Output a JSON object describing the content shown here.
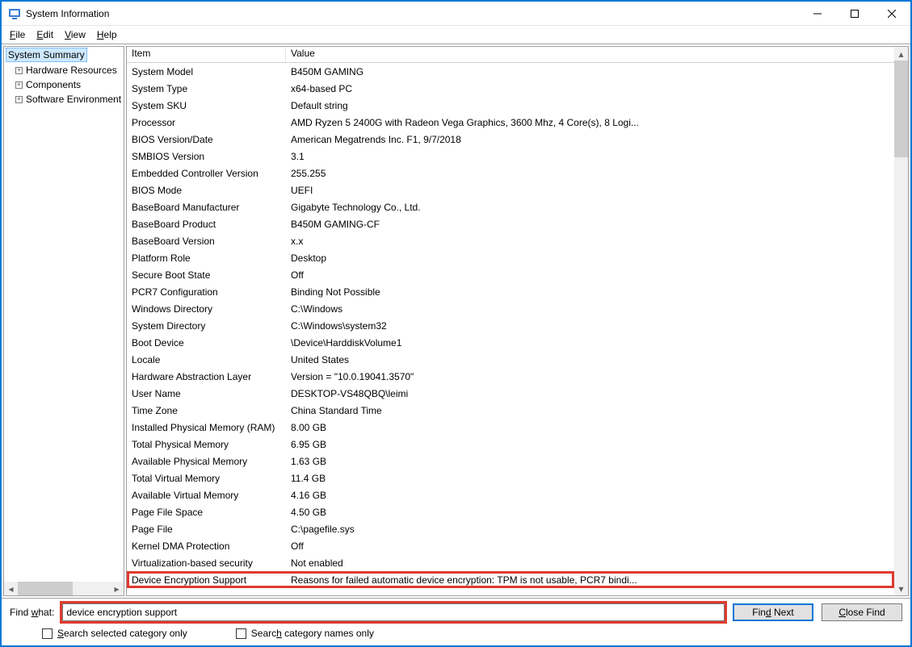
{
  "window": {
    "title": "System Information"
  },
  "menu": {
    "file": "File",
    "edit": "Edit",
    "view": "View",
    "help": "Help"
  },
  "tree": {
    "root": "System Summary",
    "children": [
      "Hardware Resources",
      "Components",
      "Software Environment"
    ]
  },
  "grid": {
    "headers": {
      "item": "Item",
      "value": "Value"
    },
    "rows": [
      {
        "item": "System Model",
        "value": "B450M GAMING"
      },
      {
        "item": "System Type",
        "value": "x64-based PC"
      },
      {
        "item": "System SKU",
        "value": "Default string"
      },
      {
        "item": "Processor",
        "value": "AMD Ryzen 5 2400G with Radeon Vega Graphics, 3600 Mhz, 4 Core(s), 8 Logi..."
      },
      {
        "item": "BIOS Version/Date",
        "value": "American Megatrends Inc. F1, 9/7/2018"
      },
      {
        "item": "SMBIOS Version",
        "value": "3.1"
      },
      {
        "item": "Embedded Controller Version",
        "value": "255.255"
      },
      {
        "item": "BIOS Mode",
        "value": "UEFI"
      },
      {
        "item": "BaseBoard Manufacturer",
        "value": "Gigabyte Technology Co., Ltd."
      },
      {
        "item": "BaseBoard Product",
        "value": "B450M GAMING-CF"
      },
      {
        "item": "BaseBoard Version",
        "value": "x.x"
      },
      {
        "item": "Platform Role",
        "value": "Desktop"
      },
      {
        "item": "Secure Boot State",
        "value": "Off"
      },
      {
        "item": "PCR7 Configuration",
        "value": "Binding Not Possible"
      },
      {
        "item": "Windows Directory",
        "value": "C:\\Windows"
      },
      {
        "item": "System Directory",
        "value": "C:\\Windows\\system32"
      },
      {
        "item": "Boot Device",
        "value": "\\Device\\HarddiskVolume1"
      },
      {
        "item": "Locale",
        "value": "United States"
      },
      {
        "item": "Hardware Abstraction Layer",
        "value": "Version = \"10.0.19041.3570\""
      },
      {
        "item": "User Name",
        "value": "DESKTOP-VS48QBQ\\leimi"
      },
      {
        "item": "Time Zone",
        "value": "China Standard Time"
      },
      {
        "item": "Installed Physical Memory (RAM)",
        "value": "8.00 GB"
      },
      {
        "item": "Total Physical Memory",
        "value": "6.95 GB"
      },
      {
        "item": "Available Physical Memory",
        "value": "1.63 GB"
      },
      {
        "item": "Total Virtual Memory",
        "value": "11.4 GB"
      },
      {
        "item": "Available Virtual Memory",
        "value": "4.16 GB"
      },
      {
        "item": "Page File Space",
        "value": "4.50 GB"
      },
      {
        "item": "Page File",
        "value": "C:\\pagefile.sys"
      },
      {
        "item": "Kernel DMA Protection",
        "value": "Off"
      },
      {
        "item": "Virtualization-based security",
        "value": "Not enabled"
      },
      {
        "item": "Device Encryption Support",
        "value": "Reasons for failed automatic device encryption: TPM is not usable, PCR7 bindi...",
        "highlight": true
      }
    ]
  },
  "find": {
    "label": "Find what:",
    "value": "device encryption support",
    "findNext": "Find Next",
    "closeFind": "Close Find",
    "opt1": "Search selected category only",
    "opt2": "Search category names only"
  }
}
